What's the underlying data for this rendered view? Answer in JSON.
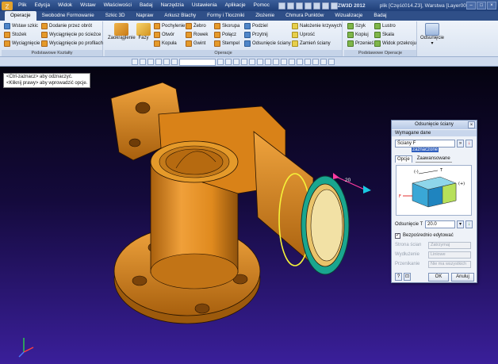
{
  "window": {
    "title": "ZW3D 2012",
    "file_info": "plik [Część014.Z3], Warstwa [Layer0000]"
  },
  "menu": [
    "Plik",
    "Edycja",
    "Widok",
    "Wstaw",
    "Właściwości",
    "Badaj",
    "Narzędzia",
    "Ustawienia",
    "Aplikacje",
    "Pomoc"
  ],
  "tabs": [
    "Operacje",
    "Swobodne Formowanie",
    "Szkic 3D",
    "Napraw",
    "Arkusz Blachy",
    "Formy i Tłoczniki",
    "Złożenie",
    "Chmura Punktów",
    "Wizualizacje",
    "Badaj"
  ],
  "ribbon": {
    "basic_shapes": {
      "label": "Podstawowe Kształty",
      "items": [
        "Wstaw szkic",
        "Dodanie przez obrót",
        "Stożek",
        "Wyciągnięcie po ścieżce",
        "Wyciągnięcie",
        "Wyciągnięcie po profilach"
      ]
    },
    "operations": {
      "label": "Operacje",
      "big": [
        "Zaokrąglenie",
        "Fazy"
      ],
      "col1": [
        "Pochylenie",
        "Otwór",
        "Kopuła"
      ],
      "col2": [
        "Żebro",
        "Rowek",
        "Gwint"
      ],
      "col3": [
        "Skorupa",
        "Połącz",
        "Stempel"
      ],
      "col4": [
        "Podziel",
        "Przytnij",
        "Odsunięcie ściany"
      ],
      "col5": [
        "Nałożenie krzywych",
        "Uprość",
        "Zamień ściany"
      ]
    },
    "basic_ops": {
      "label": "Podstawowe Operacje",
      "col1": [
        "Szyk",
        "Kopiuj",
        "Przenieś"
      ],
      "col2": [
        "Lustro",
        "Skala",
        "Widok przekroju"
      ]
    },
    "offset_button": "Odsunięcie"
  },
  "viewport": {
    "hint_line1": "<Ctrl-zaznacz> aby odznaczyć.",
    "hint_line2": "<Kliknij prawy> aby wprowadzić opcje.",
    "dimension": "20"
  },
  "dialog": {
    "title": "Odsunięcie ściany",
    "required_header": "Wymagane dane",
    "faces_label": "Ściany F",
    "faces_value": "zaznaczone",
    "advanced_header": "Zaawansowane",
    "tab_options": "Opcje",
    "tab_advanced": "Zaawansowane",
    "offset_label": "Odsunięcie T",
    "offset_value": "20.0",
    "direct_edit": "Bezpośrednio edytować",
    "direct_edit_checked": true,
    "side_faces_label": "Strona ścian",
    "side_faces_value": "Zatrzymaj",
    "extension_label": "Wydłużenie",
    "extension_value": "Liniowe",
    "intersection_label": "Przenikanie",
    "intersection_value": "Nie ma wszystkich",
    "ok": "OK",
    "cancel": "Anuluj",
    "preview_labels": [
      "(-)",
      "T",
      "(+)",
      "F"
    ]
  },
  "colors": {
    "part": "#e08a1e",
    "part_shadow": "#9c5a0c",
    "highlight_face": "#1aa68f",
    "edge_highlight": "#f5f23a"
  }
}
